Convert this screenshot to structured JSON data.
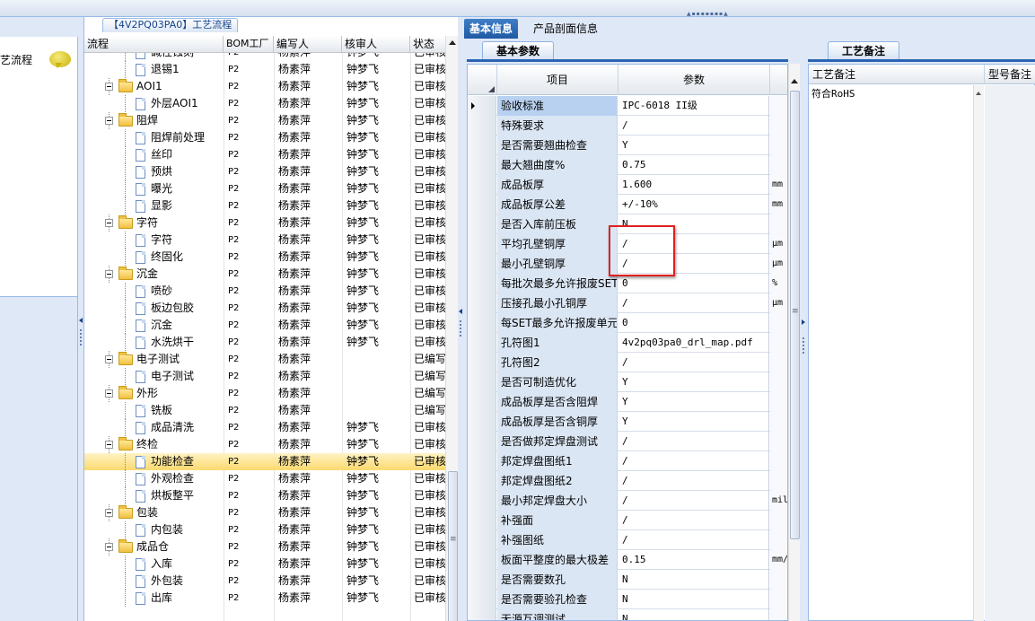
{
  "left_nav": {
    "item_label": "艺流程"
  },
  "tree": {
    "title": "【4V2PQ03PA0】工艺流程",
    "columns": [
      "流程",
      "BOM工厂",
      "编写人",
      "核审人",
      "状态"
    ],
    "rows": [
      {
        "type": "leaf",
        "name": "碱性蚀刻",
        "bom": "P2",
        "writer": "杨素萍",
        "reviewer": "钟梦飞",
        "status": "已审核"
      },
      {
        "type": "leaf",
        "name": "退锡1",
        "bom": "P2",
        "writer": "杨素萍",
        "reviewer": "钟梦飞",
        "status": "已审核"
      },
      {
        "type": "folder",
        "name": "AOI1",
        "bom": "P2",
        "writer": "杨素萍",
        "reviewer": "钟梦飞",
        "status": "已审核"
      },
      {
        "type": "leaf",
        "name": "外层AOI1",
        "bom": "P2",
        "writer": "杨素萍",
        "reviewer": "钟梦飞",
        "status": "已审核"
      },
      {
        "type": "folder",
        "name": "阻焊",
        "bom": "P2",
        "writer": "杨素萍",
        "reviewer": "钟梦飞",
        "status": "已审核"
      },
      {
        "type": "leaf",
        "name": "阻焊前处理",
        "bom": "P2",
        "writer": "杨素萍",
        "reviewer": "钟梦飞",
        "status": "已审核"
      },
      {
        "type": "leaf",
        "name": "丝印",
        "bom": "P2",
        "writer": "杨素萍",
        "reviewer": "钟梦飞",
        "status": "已审核"
      },
      {
        "type": "leaf",
        "name": "预烘",
        "bom": "P2",
        "writer": "杨素萍",
        "reviewer": "钟梦飞",
        "status": "已审核"
      },
      {
        "type": "leaf",
        "name": "曝光",
        "bom": "P2",
        "writer": "杨素萍",
        "reviewer": "钟梦飞",
        "status": "已审核"
      },
      {
        "type": "leaf",
        "name": "显影",
        "bom": "P2",
        "writer": "杨素萍",
        "reviewer": "钟梦飞",
        "status": "已审核"
      },
      {
        "type": "folder",
        "name": "字符",
        "bom": "P2",
        "writer": "杨素萍",
        "reviewer": "钟梦飞",
        "status": "已审核"
      },
      {
        "type": "leaf",
        "name": "字符",
        "bom": "P2",
        "writer": "杨素萍",
        "reviewer": "钟梦飞",
        "status": "已审核"
      },
      {
        "type": "leaf",
        "name": "终固化",
        "bom": "P2",
        "writer": "杨素萍",
        "reviewer": "钟梦飞",
        "status": "已审核"
      },
      {
        "type": "folder",
        "name": "沉金",
        "bom": "P2",
        "writer": "杨素萍",
        "reviewer": "钟梦飞",
        "status": "已审核"
      },
      {
        "type": "leaf",
        "name": "喷砂",
        "bom": "P2",
        "writer": "杨素萍",
        "reviewer": "钟梦飞",
        "status": "已审核"
      },
      {
        "type": "leaf",
        "name": "板边包胶",
        "bom": "P2",
        "writer": "杨素萍",
        "reviewer": "钟梦飞",
        "status": "已审核"
      },
      {
        "type": "leaf",
        "name": "沉金",
        "bom": "P2",
        "writer": "杨素萍",
        "reviewer": "钟梦飞",
        "status": "已审核"
      },
      {
        "type": "leaf",
        "name": "水洗烘干",
        "bom": "P2",
        "writer": "杨素萍",
        "reviewer": "钟梦飞",
        "status": "已审核"
      },
      {
        "type": "folder",
        "name": "电子测试",
        "bom": "P2",
        "writer": "杨素萍",
        "reviewer": "",
        "status": "已编写"
      },
      {
        "type": "leaf",
        "name": "电子测试",
        "bom": "P2",
        "writer": "杨素萍",
        "reviewer": "",
        "status": "已编写"
      },
      {
        "type": "folder",
        "name": "外形",
        "bom": "P2",
        "writer": "杨素萍",
        "reviewer": "",
        "status": "已编写"
      },
      {
        "type": "leaf",
        "name": "铣板",
        "bom": "P2",
        "writer": "杨素萍",
        "reviewer": "",
        "status": "已编写"
      },
      {
        "type": "leaf",
        "name": "成品清洗",
        "bom": "P2",
        "writer": "杨素萍",
        "reviewer": "钟梦飞",
        "status": "已审核"
      },
      {
        "type": "folder",
        "name": "终检",
        "bom": "P2",
        "writer": "杨素萍",
        "reviewer": "钟梦飞",
        "status": "已审核"
      },
      {
        "type": "leaf",
        "name": "功能检查",
        "bom": "P2",
        "writer": "杨素萍",
        "reviewer": "钟梦飞",
        "status": "已审核",
        "selected": true
      },
      {
        "type": "leaf",
        "name": "外观检查",
        "bom": "P2",
        "writer": "杨素萍",
        "reviewer": "钟梦飞",
        "status": "已审核"
      },
      {
        "type": "leaf",
        "name": "烘板整平",
        "bom": "P2",
        "writer": "杨素萍",
        "reviewer": "钟梦飞",
        "status": "已审核"
      },
      {
        "type": "folder",
        "name": "包装",
        "bom": "P2",
        "writer": "杨素萍",
        "reviewer": "钟梦飞",
        "status": "已审核"
      },
      {
        "type": "leaf",
        "name": "内包装",
        "bom": "P2",
        "writer": "杨素萍",
        "reviewer": "钟梦飞",
        "status": "已审核"
      },
      {
        "type": "folder",
        "name": "成品仓",
        "bom": "P2",
        "writer": "杨素萍",
        "reviewer": "钟梦飞",
        "status": "已审核"
      },
      {
        "type": "leaf",
        "name": "入库",
        "bom": "P2",
        "writer": "杨素萍",
        "reviewer": "钟梦飞",
        "status": "已审核"
      },
      {
        "type": "leaf",
        "name": "外包装",
        "bom": "P2",
        "writer": "杨素萍",
        "reviewer": "钟梦飞",
        "status": "已审核"
      },
      {
        "type": "leaf",
        "name": "出库",
        "bom": "P2",
        "writer": "杨素萍",
        "reviewer": "钟梦飞",
        "status": "已审核"
      }
    ]
  },
  "main_tabs": [
    "基本信息",
    "产品剖面信息"
  ],
  "basic_params": {
    "tab_label": "基本参数",
    "columns": [
      "项目",
      "参数"
    ],
    "rows": [
      {
        "name": "验收标准",
        "value": "IPC-6018 II级",
        "unit": "",
        "current": true
      },
      {
        "name": "特殊要求",
        "value": "/",
        "unit": ""
      },
      {
        "name": "是否需要翘曲检查",
        "value": "Y",
        "unit": ""
      },
      {
        "name": "最大翘曲度%",
        "value": "0.75",
        "unit": ""
      },
      {
        "name": "成品板厚",
        "value": "1.600",
        "unit": "mm"
      },
      {
        "name": "成品板厚公差",
        "value": "+/-10%",
        "unit": "mm"
      },
      {
        "name": "是否入库前压板",
        "value": "N",
        "unit": ""
      },
      {
        "name": "平均孔壁铜厚",
        "value": "/",
        "unit": "μm"
      },
      {
        "name": "最小孔壁铜厚",
        "value": "/",
        "unit": "μm"
      },
      {
        "name": "每批次最多允许报废SET",
        "value": "0",
        "unit": "%"
      },
      {
        "name": "压接孔最小孔铜厚",
        "value": "/",
        "unit": "μm"
      },
      {
        "name": "每SET最多允许报废单元",
        "value": "0",
        "unit": ""
      },
      {
        "name": "孔符图1",
        "value": "4v2pq03pa0_drl_map.pdf",
        "unit": ""
      },
      {
        "name": "孔符图2",
        "value": "/",
        "unit": ""
      },
      {
        "name": "是否可制造优化",
        "value": "Y",
        "unit": ""
      },
      {
        "name": "成品板厚是否含阻焊",
        "value": "Y",
        "unit": ""
      },
      {
        "name": "成品板厚是否含铜厚",
        "value": "Y",
        "unit": ""
      },
      {
        "name": "是否做邦定焊盘测试",
        "value": "/",
        "unit": ""
      },
      {
        "name": "邦定焊盘图纸1",
        "value": "/",
        "unit": ""
      },
      {
        "name": "邦定焊盘图纸2",
        "value": "/",
        "unit": ""
      },
      {
        "name": "最小邦定焊盘大小",
        "value": "/",
        "unit": "mil"
      },
      {
        "name": "补强面",
        "value": "/",
        "unit": ""
      },
      {
        "name": "补强图纸",
        "value": "/",
        "unit": ""
      },
      {
        "name": "板面平整度的最大极差",
        "value": "0.15",
        "unit": "mm/:"
      },
      {
        "name": "是否需要数孔",
        "value": "N",
        "unit": ""
      },
      {
        "name": "是否需要验孔检查",
        "value": "N",
        "unit": ""
      },
      {
        "name": "无源互调测试",
        "value": "N",
        "unit": ""
      }
    ]
  },
  "notes": {
    "tab_label": "工艺备注",
    "columns": [
      "工艺备注",
      "型号备注"
    ],
    "content": "符合RoHS"
  }
}
